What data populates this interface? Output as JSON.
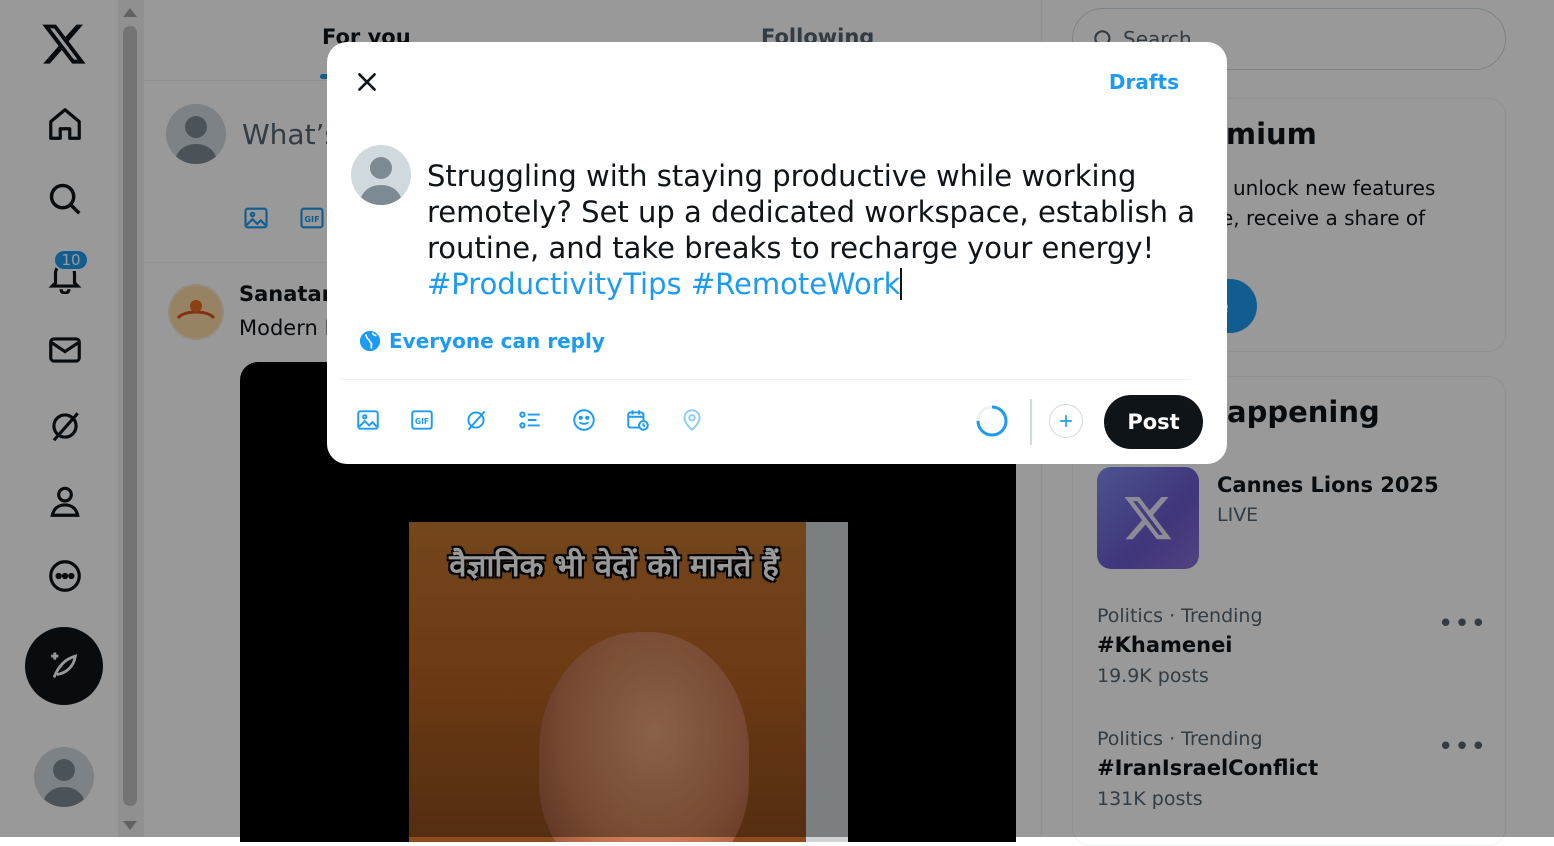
{
  "nav": {
    "notification_count": "10"
  },
  "main": {
    "tabs": [
      {
        "label": "For you"
      },
      {
        "label": "Following"
      }
    ],
    "composer_placeholder": "What’s",
    "post": {
      "author": "Sanatan",
      "text": "Modern I",
      "video_caption": "वैज्ञानिक भी वेदों को मानते हैं"
    }
  },
  "right": {
    "search_placeholder": "Search",
    "premium": {
      "title": "e to Premium",
      "desc_line1": "unlock new features",
      "desc_line2": "e, receive a share of",
      "button": "e"
    },
    "happening": {
      "title": "appening",
      "live": {
        "title": "Cannes Lions 2025",
        "tag": "LIVE"
      },
      "trends": [
        {
          "meta": "Politics · Trending",
          "name": "#Khamenei",
          "count": "19.9K posts"
        },
        {
          "meta": "Politics · Trending",
          "name": "#IranIsraelConflict",
          "count": "131K posts"
        }
      ]
    }
  },
  "modal": {
    "drafts_label": "Drafts",
    "text_main": "Struggling with staying productive while working remotely? Set up a dedicated workspace, establish a routine, and take breaks to recharge your energy!",
    "hashtag1": "#ProductivityTips",
    "hashtag2": "#RemoteWork",
    "reply_setting": "Everyone can reply",
    "post_label": "Post"
  },
  "colors": {
    "accent": "#1d9bf0",
    "text": "#0f1419",
    "muted": "#536471",
    "overlay": "rgba(0,0,0,0.4)"
  },
  "icons": [
    "x-logo-icon",
    "home-icon",
    "search-icon",
    "bell-icon",
    "mail-icon",
    "grok-icon",
    "profile-icon",
    "more-circle-icon",
    "compose-feather-icon",
    "close-icon",
    "globe-icon",
    "image-icon",
    "gif-icon",
    "grok-icon",
    "poll-icon",
    "emoji-icon",
    "schedule-icon",
    "location-icon",
    "add-icon"
  ]
}
